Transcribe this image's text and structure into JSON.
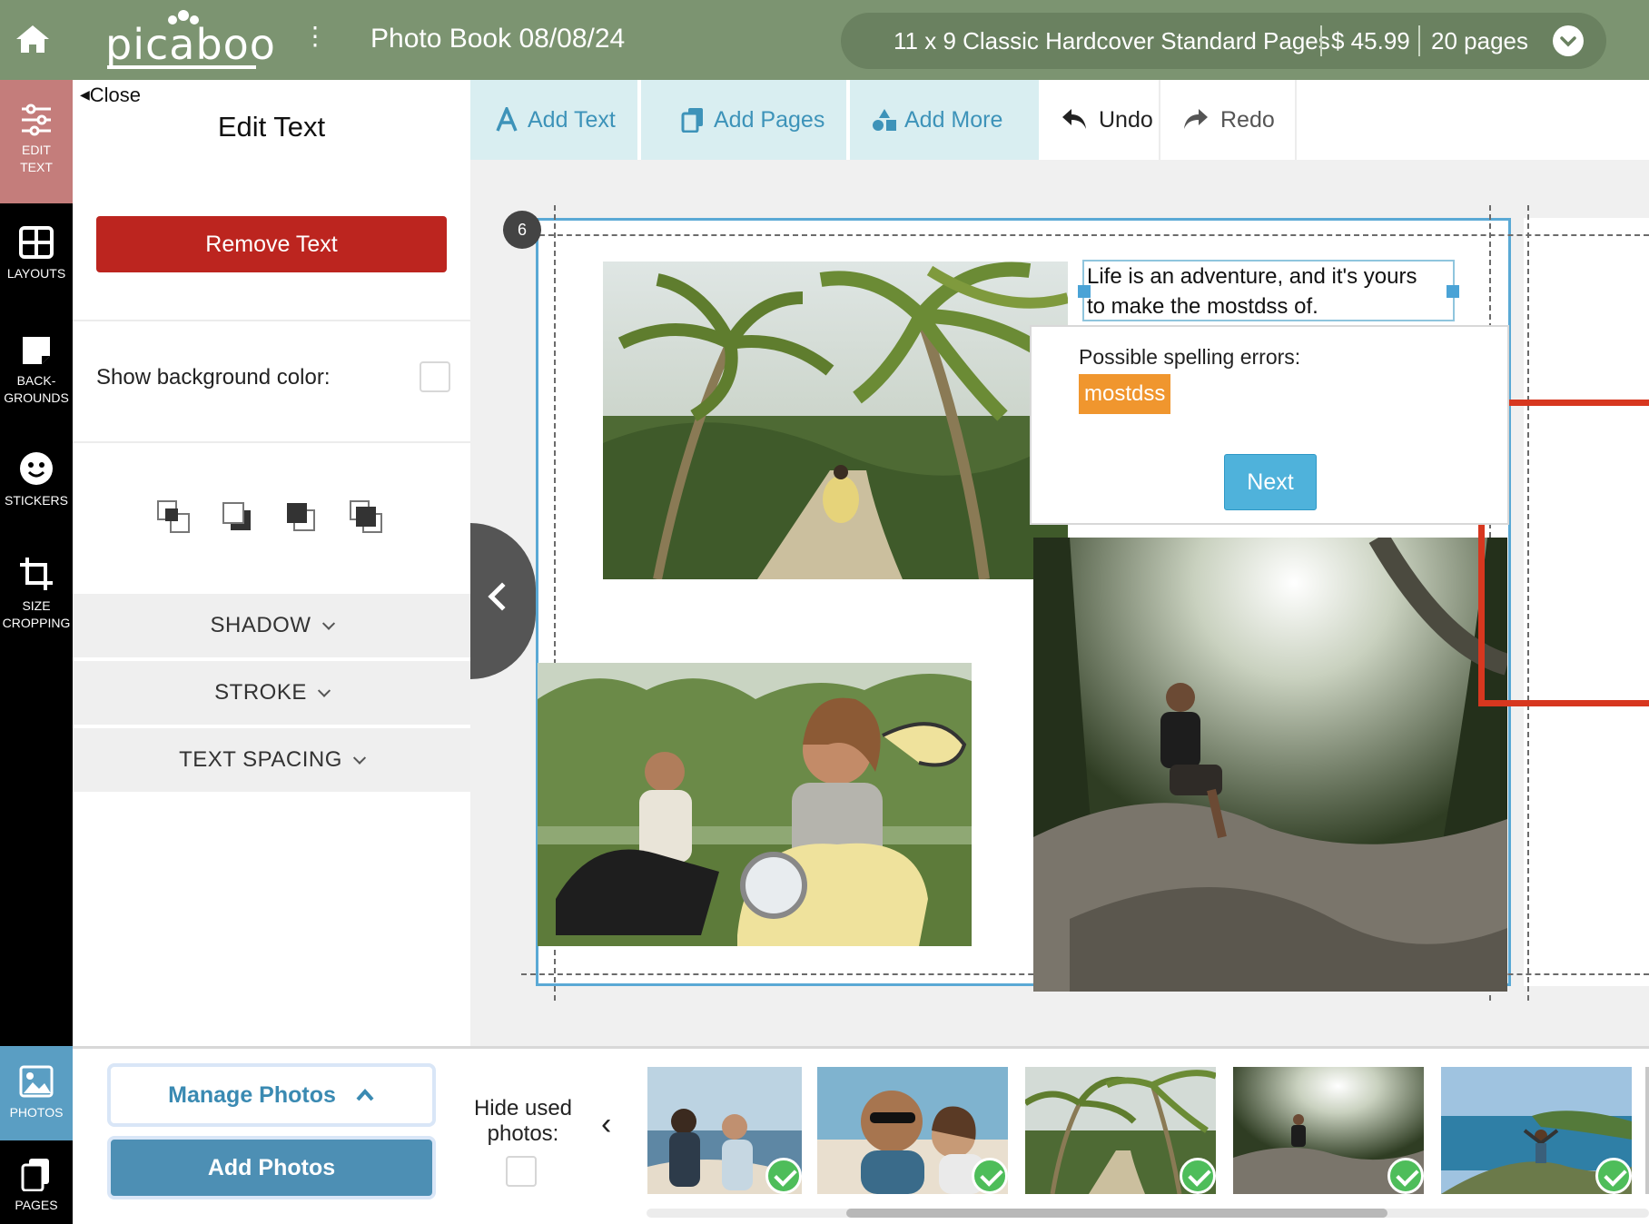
{
  "header": {
    "logo_text": "picaboo",
    "book_title": "Photo Book 08/08/24",
    "product": "11 x 9 Classic Hardcover Standard Pages",
    "price": "$ 45.99",
    "pages": "20 pages",
    "colors": {
      "bar": "#7c9471",
      "pill": "#6a8160"
    }
  },
  "leftnav": {
    "edit_text": {
      "line1": "EDIT",
      "line2": "TEXT",
      "icon": "sliders-icon"
    },
    "layouts": {
      "label": "LAYOUTS",
      "icon": "layout-grid-icon"
    },
    "backgrounds": {
      "line1": "BACK-",
      "line2": "GROUNDS",
      "icon": "background-icon"
    },
    "stickers": {
      "label": "STICKERS",
      "icon": "smiley-icon"
    },
    "size_cropping": {
      "line1": "SIZE",
      "line2": "CROPPING",
      "icon": "crop-icon"
    },
    "photos": {
      "label": "PHOTOS",
      "icon": "photo-icon"
    },
    "pages": {
      "label": "PAGES",
      "icon": "pages-icon"
    }
  },
  "panel": {
    "close": "Close",
    "title": "Edit Text",
    "remove_text": "Remove Text",
    "show_background_label": "Show background color:",
    "show_background_checked": false,
    "arrange_icons": [
      "bring-to-front-icon",
      "send-backward-icon",
      "bring-forward-icon",
      "send-to-back-icon"
    ],
    "accordions": [
      "SHADOW",
      "STROKE",
      "TEXT SPACING"
    ]
  },
  "toolbar": {
    "add_text": "Add Text",
    "add_pages": "Add Pages",
    "add_more": "Add More",
    "undo": "Undo",
    "redo": "Redo"
  },
  "canvas": {
    "page_number": "6",
    "text_line1": "Life is an adventure, and it's yours",
    "text_line2": "to make the mostdss of.",
    "spell_label": "Possible spelling errors:",
    "misspelled_word": "mostdss",
    "next": "Next",
    "photos": [
      "palm-trees-scooter-photo",
      "couple-on-scooters-photo",
      "man-on-rock-forest-photo"
    ]
  },
  "bottom": {
    "manage_photos": "Manage Photos",
    "add_photos": "Add Photos",
    "hide_used_line1": "Hide used",
    "hide_used_line2": "photos:",
    "hide_used_checked": false,
    "thumbnails": [
      {
        "name": "beach-couple-thumb",
        "used": true
      },
      {
        "name": "selfie-couple-thumb",
        "used": true
      },
      {
        "name": "palm-road-thumb",
        "used": true
      },
      {
        "name": "forest-rock-thumb",
        "used": true
      },
      {
        "name": "coast-hike-thumb",
        "used": true
      }
    ]
  }
}
